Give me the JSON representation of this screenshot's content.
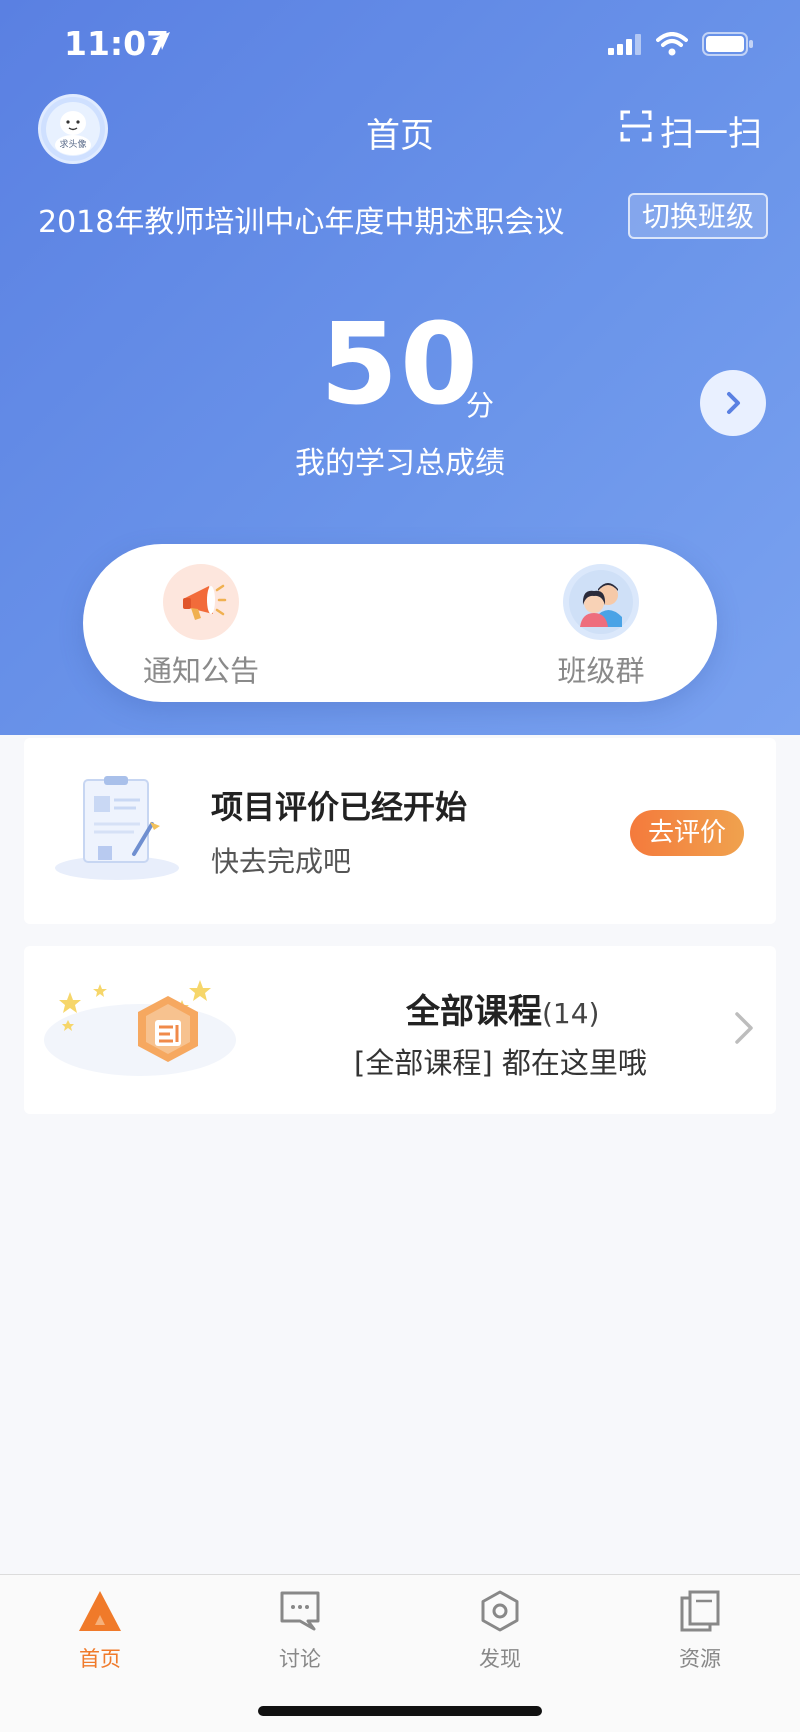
{
  "status_bar": {
    "time": "11:07"
  },
  "header": {
    "avatar_text": "求头像",
    "title": "首页",
    "scan_label": "扫一扫"
  },
  "class_info": {
    "name": "2018年教师培训中心年度中期述职会议",
    "switch_label": "切换班级"
  },
  "score": {
    "value": "50",
    "unit": "分",
    "label": "我的学习总成绩"
  },
  "quick_actions": [
    {
      "label": "通知公告",
      "icon": "megaphone-icon"
    },
    {
      "label": "班级群",
      "icon": "group-icon"
    }
  ],
  "evaluation": {
    "title": "项目评价已经开始",
    "subtitle": "快去完成吧",
    "button_label": "去评价"
  },
  "courses": {
    "title": "全部课程",
    "count": "(14)",
    "subtitle": "[全部课程] 都在这里哦"
  },
  "tabs": [
    {
      "label": "首页",
      "icon": "home-triangle-icon",
      "active": true
    },
    {
      "label": "讨论",
      "icon": "chat-icon",
      "active": false
    },
    {
      "label": "发现",
      "icon": "hexagon-icon",
      "active": false
    },
    {
      "label": "资源",
      "icon": "documents-icon",
      "active": false
    }
  ],
  "colors": {
    "hero_blue": "#5a80e2",
    "accent_orange": "#f07a2a"
  }
}
